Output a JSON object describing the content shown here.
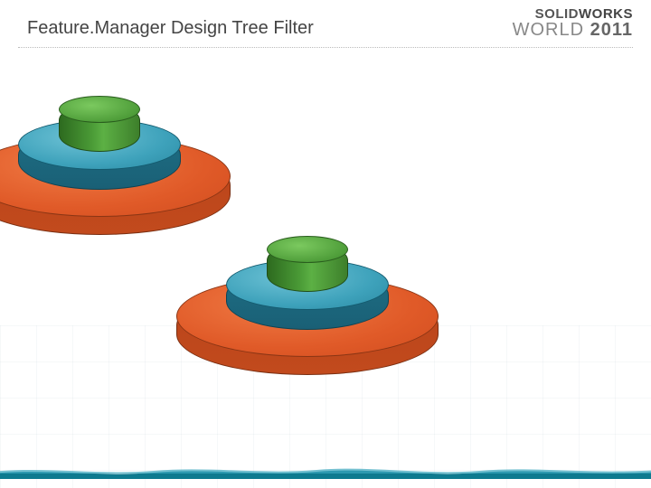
{
  "title": "Feature.Manager Design Tree Filter",
  "logo": {
    "brand_prefix": "SOLID",
    "brand_suffix": "WORKS",
    "event": "WORLD",
    "year": "2011"
  }
}
